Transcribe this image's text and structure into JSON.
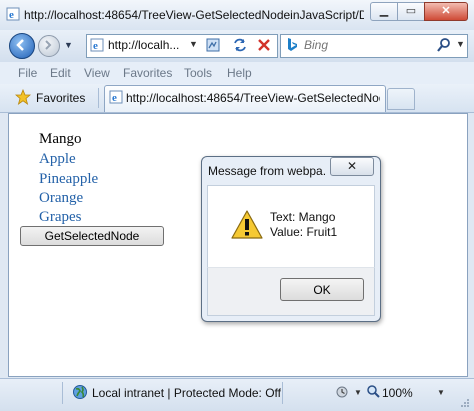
{
  "window": {
    "title": "http://localhost:48654/TreeView-GetSelectedNodeinJavaScript/D...",
    "minimize_glyph": "▁",
    "maximize_glyph": "▭",
    "close_glyph": "✕"
  },
  "nav": {
    "address": "http://localh...",
    "search_placeholder": "Bing",
    "dropdown_glyph": "▼"
  },
  "menu": {
    "items": [
      "File",
      "Edit",
      "View",
      "Favorites",
      "Tools",
      "Help"
    ]
  },
  "favorites_bar": {
    "label": "Favorites",
    "tab_title": "http://localhost:48654/TreeView-GetSelectedNod..."
  },
  "tree": {
    "selected": "Mango",
    "items": [
      "Apple",
      "Pineapple",
      "Orange",
      "Grapes"
    ]
  },
  "page_button": "GetSelectedNode",
  "dialog": {
    "title": "Message from webpa...",
    "close_glyph": "✕",
    "line1": "Text: Mango",
    "line2": "Value: Fruit1",
    "ok_label": "OK"
  },
  "status": {
    "zone": "Local intranet | Protected Mode: Off",
    "zoom": "100%"
  },
  "colors": {
    "link": "#2361a8",
    "chrome": "#dfe8f3"
  }
}
